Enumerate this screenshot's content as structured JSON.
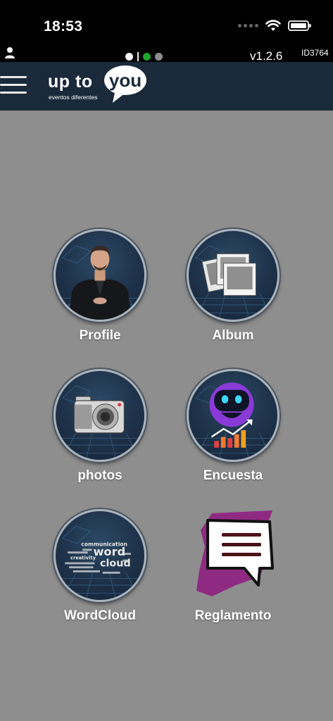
{
  "status_bar": {
    "time": "18:53",
    "icons": [
      "cellular-dots-icon",
      "wifi-icon",
      "battery-icon"
    ]
  },
  "info_bar": {
    "user_icon": "user-icon",
    "page_indicators": [
      {
        "state": "inactive",
        "color": "#f2f2f2"
      },
      {
        "state": "separator",
        "color": "#f2f2f2"
      },
      {
        "state": "active",
        "color": "#1fa52b"
      },
      {
        "state": "inactive",
        "color": "#8d8d8d"
      }
    ],
    "version": "v1.2.6",
    "device_id": "ID3764"
  },
  "header": {
    "menu_icon": "hamburger-menu-icon",
    "logo": {
      "text_1": "up to",
      "text_2": "you",
      "tagline": "eventos diferentes"
    }
  },
  "colors": {
    "header_bg": "#1b2a3a",
    "content_bg": "#8e8e8e",
    "tile_ring": "#aab2bb"
  },
  "menu": [
    {
      "label": "Profile",
      "icon": "profile-photo"
    },
    {
      "label": "Album",
      "icon": "photo-album-icon"
    },
    {
      "label": "photos",
      "icon": "camera-icon"
    },
    {
      "label": "Encuesta",
      "icon": "robot-chart-icon"
    },
    {
      "label": "WordCloud",
      "icon": "word-cloud-icon",
      "art_words": [
        "communication",
        "word",
        "cloud",
        "creativity"
      ]
    },
    {
      "label": "Reglamento",
      "icon": "speech-bubble-icon"
    }
  ]
}
